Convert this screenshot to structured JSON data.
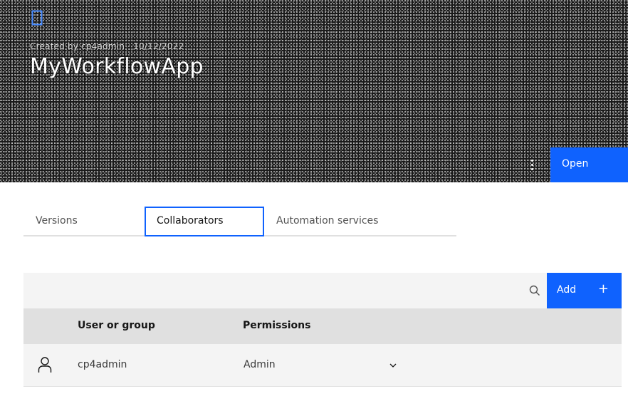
{
  "header": {
    "meta": "Created by cp4admin · 10/12/2022",
    "title": "MyWorkflowApp",
    "open_label": "Open",
    "icon": "app-document-icon"
  },
  "tabs": [
    {
      "label": "Versions",
      "selected": false
    },
    {
      "label": "Collaborators",
      "selected": true
    },
    {
      "label": "Automation services",
      "selected": false
    }
  ],
  "toolbar": {
    "search_icon": "search-icon",
    "add_label": "Add",
    "add_icon": "+"
  },
  "table": {
    "columns": [
      "",
      "User or group",
      "Permissions"
    ],
    "rows": [
      {
        "icon": "user-icon",
        "name": "cp4admin",
        "permission": "Admin"
      }
    ]
  },
  "colors": {
    "accent": "#0f62fe",
    "toolbar_bg": "#f4f4f4",
    "header_row_bg": "#e0e0e0"
  }
}
